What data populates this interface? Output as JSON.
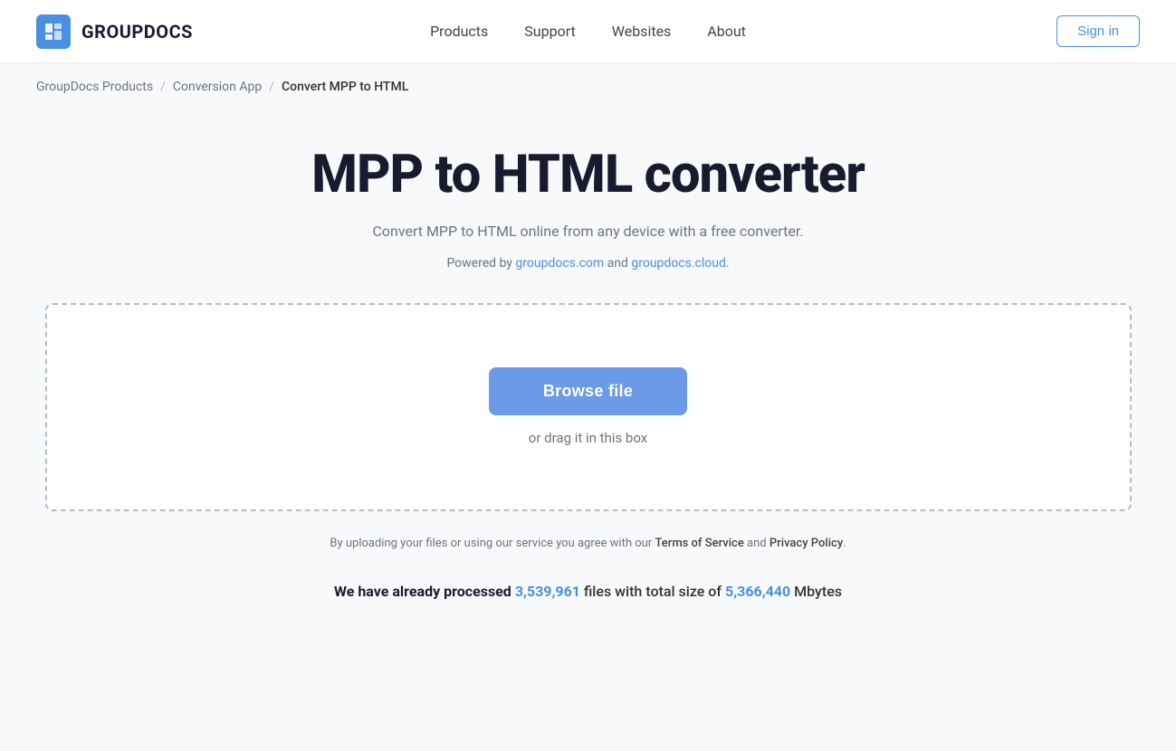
{
  "header": {
    "logo_text": "GROUPDOCS",
    "nav": {
      "items": [
        {
          "label": "Products",
          "id": "products"
        },
        {
          "label": "Support",
          "id": "support"
        },
        {
          "label": "Websites",
          "id": "websites"
        },
        {
          "label": "About",
          "id": "about"
        }
      ]
    },
    "sign_in_label": "Sign in"
  },
  "breadcrumb": {
    "items": [
      {
        "label": "GroupDocs Products",
        "id": "groupdocs-products"
      },
      {
        "label": "Conversion App",
        "id": "conversion-app"
      },
      {
        "label": "Convert MPP to HTML",
        "id": "current"
      }
    ],
    "separator": "/"
  },
  "main": {
    "title": "MPP to HTML converter",
    "subtitle": "Convert MPP to HTML online from any device with a free converter.",
    "powered_by": {
      "prefix": "Powered by",
      "link1_label": "groupdocs.com",
      "link1_url": "#",
      "middle": "and",
      "link2_label": "groupdocs.cloud",
      "link2_url": "#",
      "suffix": "."
    },
    "drop_zone": {
      "browse_label": "Browse file",
      "drag_text": "or drag it in this box"
    },
    "terms": {
      "prefix": "By uploading your files or using our service you agree with our",
      "tos_label": "Terms of Service",
      "middle": "and",
      "privacy_label": "Privacy Policy",
      "suffix": "."
    },
    "stats": {
      "prefix": "We have already processed",
      "files_count": "3,539,961",
      "middle": "files with total size of",
      "size_count": "5,366,440",
      "suffix": "Mbytes"
    }
  }
}
